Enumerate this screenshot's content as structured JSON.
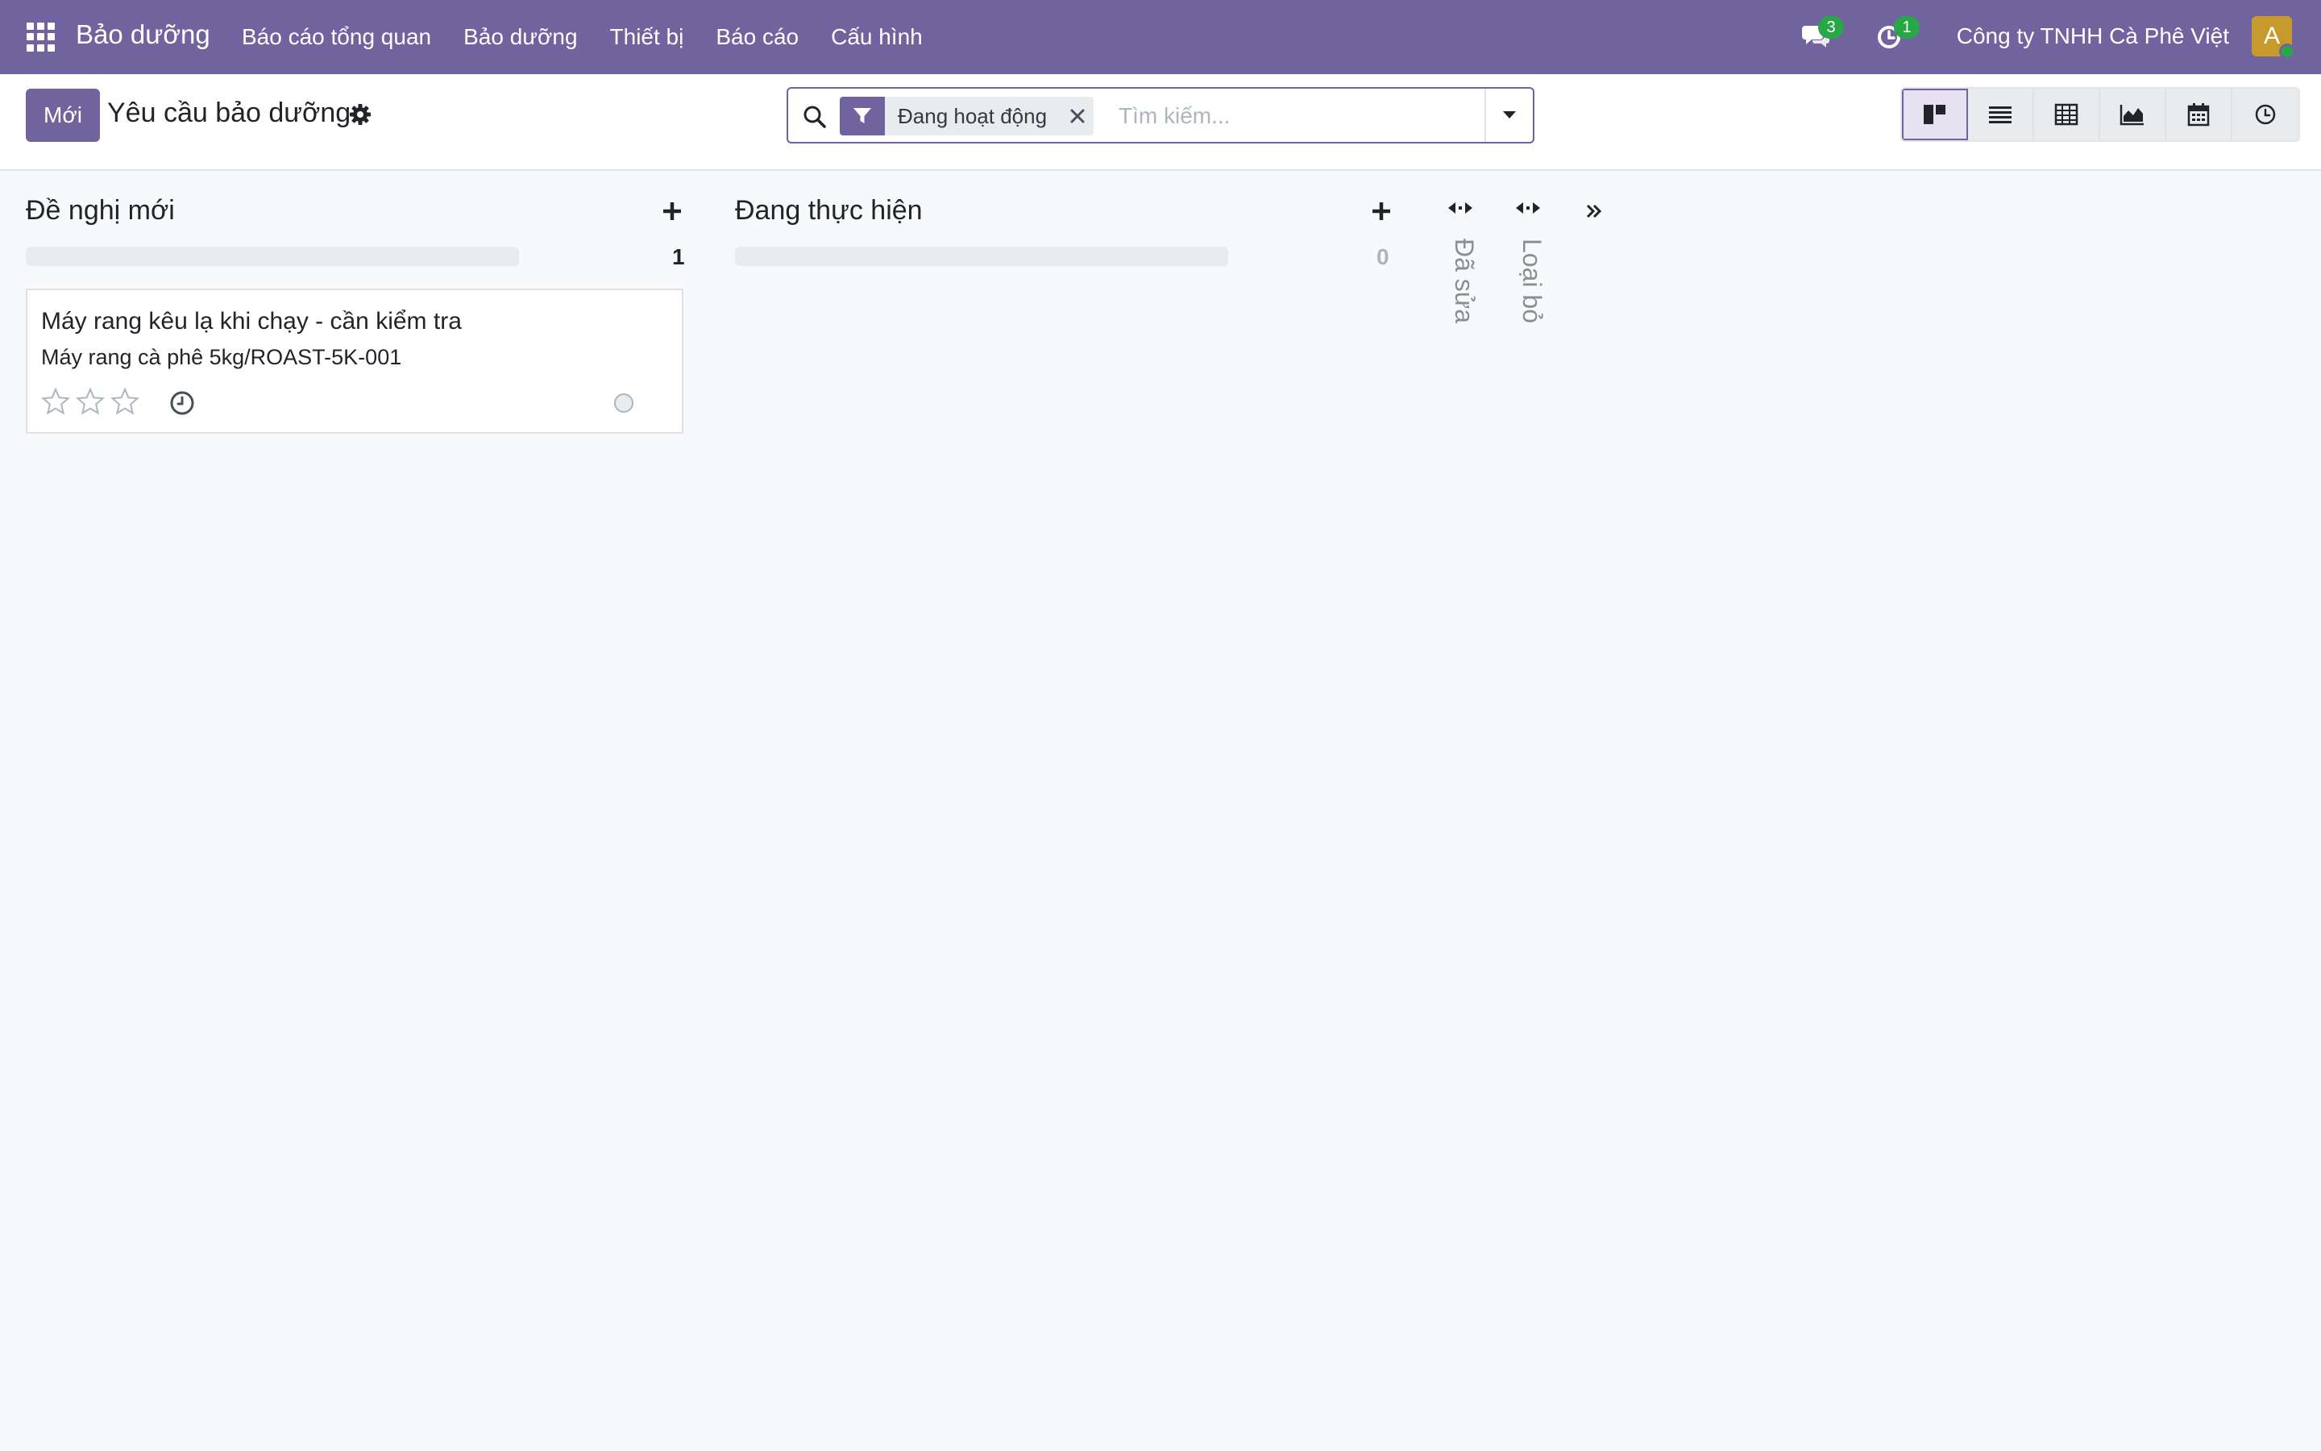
{
  "navbar": {
    "app_name": "Bảo dưỡng",
    "menu": [
      {
        "label": "Báo cáo tổng quan"
      },
      {
        "label": "Bảo dưỡng"
      },
      {
        "label": "Thiết bị"
      },
      {
        "label": "Báo cáo"
      },
      {
        "label": "Cấu hình"
      }
    ],
    "messages_badge": "3",
    "activities_badge": "1",
    "company": "Công ty TNHH Cà Phê Việt",
    "avatar_letter": "A"
  },
  "control_panel": {
    "new_button": "Mới",
    "title": "Yêu cầu bảo dưỡng",
    "search": {
      "facet_label": "Đang hoạt động",
      "placeholder": "Tìm kiếm..."
    },
    "views": [
      "kanban-icon",
      "list-icon",
      "pivot-icon",
      "graph-icon",
      "calendar-icon",
      "activity-icon"
    ],
    "active_view": "kanban"
  },
  "kanban": {
    "columns": [
      {
        "title": "Đề nghị mới",
        "count": "1",
        "cards": [
          {
            "title": "Máy rang kêu lạ khi chạy - cần kiểm tra",
            "subtitle": "Máy rang cà phê 5kg/ROAST-5K-001",
            "priority_stars": 0,
            "priority_max": 3
          }
        ]
      },
      {
        "title": "Đang thực hiện",
        "count": "0",
        "cards": []
      }
    ],
    "folded_columns": [
      {
        "title": "Đã sửa"
      },
      {
        "title": "Loại bỏ"
      }
    ]
  },
  "colors": {
    "brand": "#71639e",
    "badge": "#28a745",
    "background": "#f8f9fa"
  }
}
